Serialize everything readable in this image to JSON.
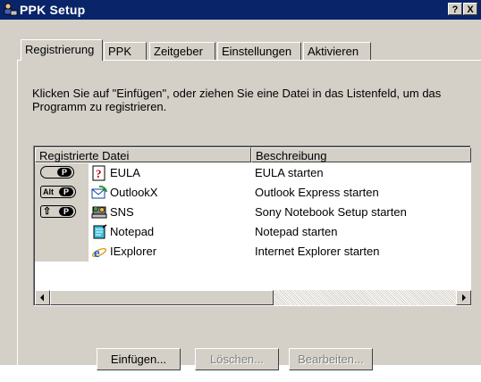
{
  "window": {
    "title": "PPK Setup",
    "help_btn": "?",
    "close_btn": "X"
  },
  "tabs": [
    {
      "label": "Registrierung",
      "active": true
    },
    {
      "label": "PPK",
      "active": false
    },
    {
      "label": "Zeitgeber",
      "active": false
    },
    {
      "label": "Einstellungen",
      "active": false
    },
    {
      "label": "Aktivieren",
      "active": false
    }
  ],
  "instruction": "Klicken Sie auf \"Einfügen\", oder ziehen Sie eine Datei in das Listenfeld, um das Programm zu registrieren.",
  "list": {
    "columns": [
      "Registrierte Datei",
      "Beschreibung"
    ],
    "rows": [
      {
        "key": "P",
        "key_mod": "",
        "icon": "help-file-icon",
        "file": "EULA",
        "description": "EULA starten"
      },
      {
        "key": "P",
        "key_mod": "Alt",
        "icon": "outlook-express-icon",
        "file": "OutlookX",
        "description": "Outlook Express starten"
      },
      {
        "key": "P",
        "key_mod": "⇧",
        "icon": "sns-setup-icon",
        "file": "SNS",
        "description": "Sony Notebook Setup starten"
      },
      {
        "key": "",
        "key_mod": "",
        "icon": "notepad-icon",
        "file": "Notepad",
        "description": "Notepad starten"
      },
      {
        "key": "",
        "key_mod": "",
        "icon": "internet-explorer-icon",
        "file": "IExplorer",
        "description": "Internet Explorer starten"
      }
    ]
  },
  "buttons": {
    "insert": "Einfügen...",
    "delete": "Löschen...",
    "edit": "Bearbeiten..."
  },
  "colors": {
    "titlebar": "#0a246a",
    "face": "#d4d0c8"
  }
}
